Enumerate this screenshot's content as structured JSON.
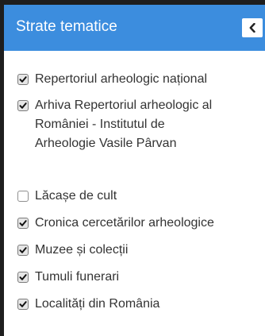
{
  "panel": {
    "title": "Strate tematice",
    "collapse_icon": "chevron-left-icon"
  },
  "layers": [
    {
      "lines": [
        "Repertoriul arheologic național"
      ],
      "checked": true
    },
    {
      "lines": [
        "Arhiva Repertoriul arheologic al",
        "României - Institutul de",
        "Arheologie Vasile Pârvan"
      ],
      "checked": true
    },
    {
      "lines": [
        "Lăcașe de cult"
      ],
      "checked": false
    },
    {
      "lines": [
        "Cronica cercetărilor arheologice"
      ],
      "checked": true
    },
    {
      "lines": [
        "Muzee și colecții"
      ],
      "checked": true
    },
    {
      "lines": [
        "Tumuli funerari"
      ],
      "checked": true
    },
    {
      "lines": [
        "Localități din România"
      ],
      "checked": true
    }
  ]
}
